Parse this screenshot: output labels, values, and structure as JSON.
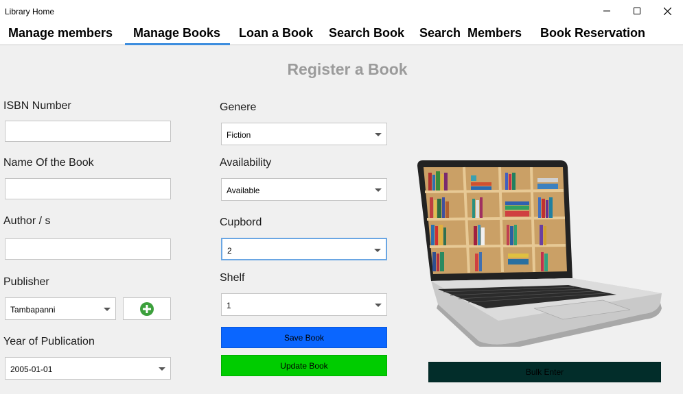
{
  "window": {
    "title": "Library Home"
  },
  "tabs": [
    {
      "label": "Manage members"
    },
    {
      "label": "Manage Books"
    },
    {
      "label": "Loan a Book"
    },
    {
      "label": "Search Book"
    },
    {
      "label": "Search  Members"
    },
    {
      "label": "Book Reservation"
    }
  ],
  "active_tab": "Manage Books",
  "form": {
    "heading": "Register a Book",
    "isbn": {
      "label": "ISBN Number",
      "value": ""
    },
    "name": {
      "label": "Name Of the Book",
      "value": ""
    },
    "author": {
      "label": "Author / s",
      "value": ""
    },
    "publisher": {
      "label": "Publisher",
      "value": "Tambapanni"
    },
    "year": {
      "label": "Year of Publication",
      "value": "2005-01-01"
    },
    "genre": {
      "label": "Genere",
      "value": "Fiction"
    },
    "availability": {
      "label": "Availability",
      "value": "Available"
    },
    "cupboard": {
      "label": "Cupbord",
      "value": "2"
    },
    "shelf": {
      "label": "Shelf",
      "value": "1"
    }
  },
  "buttons": {
    "save": "Save Book",
    "update": "Update Book",
    "bulk": "Bulk Enter"
  },
  "colors": {
    "save": "#0a66ff",
    "update": "#00cc00",
    "bulk": "#022d2a",
    "tab_underline": "#3c8dde",
    "heading": "#9b9b9b",
    "add_icon": "#3ca03c"
  },
  "icons": {
    "add": "plus-circle-icon",
    "minimize": "minimize-icon",
    "maximize": "maximize-icon",
    "close": "close-icon",
    "dropdown": "chevron-down-icon"
  }
}
